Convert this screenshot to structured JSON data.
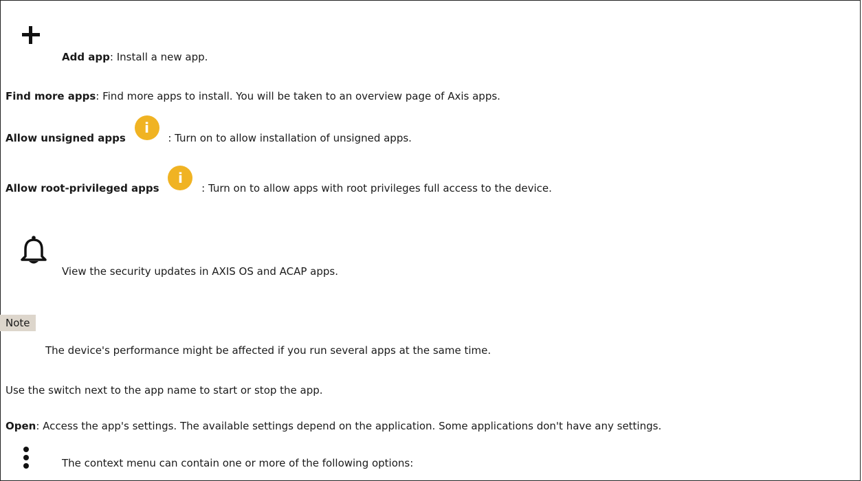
{
  "items": {
    "add_app": {
      "label": "Add app",
      "text": ": Install a new app."
    },
    "find_more": {
      "label": "Find more apps",
      "text": ": Find more apps to install. You will be taken to an overview page of Axis apps."
    },
    "allow_unsigned": {
      "label": "Allow unsigned apps",
      "text": ": Turn on to allow installation of unsigned apps."
    },
    "allow_root": {
      "label": "Allow root-privileged apps",
      "text": ": Turn on to allow apps with root privileges full access to the device."
    },
    "security_updates": {
      "text": "View the security updates in AXIS OS and ACAP apps."
    },
    "note": {
      "label": "Note",
      "text": "The device's performance might be affected if you run several apps at the same time."
    },
    "switch_info": {
      "text": "Use the switch next to the app name to start or stop the app."
    },
    "open": {
      "label": "Open",
      "text": ": Access the app's settings. The available settings depend on the application. Some applications don't have any settings."
    },
    "context_menu": {
      "text": "The context menu can contain one or more of the following options:"
    }
  },
  "icons": {
    "add": "plus-icon",
    "info": "info-icon",
    "bell": "bell-icon",
    "more": "vertical-ellipsis-icon"
  },
  "colors": {
    "info_icon": "#f0b323",
    "note_background": "#ddd6cc"
  }
}
